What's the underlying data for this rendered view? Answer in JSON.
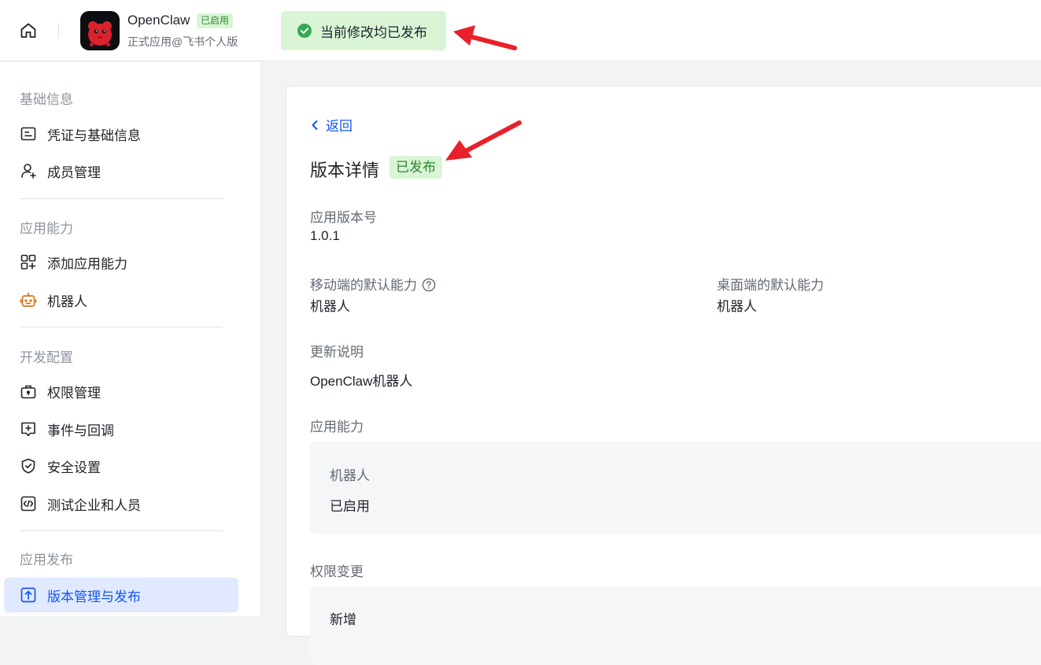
{
  "header": {
    "app_name": "OpenClaw",
    "app_status": "已启用",
    "app_subtitle": "正式应用@飞书个人版",
    "toast": "当前修改均已发布"
  },
  "sidebar": {
    "groups": [
      {
        "title": "基础信息",
        "items": [
          "凭证与基础信息",
          "成员管理"
        ]
      },
      {
        "title": "应用能力",
        "items": [
          "添加应用能力",
          "机器人"
        ]
      },
      {
        "title": "开发配置",
        "items": [
          "权限管理",
          "事件与回调",
          "安全设置",
          "测试企业和人员"
        ]
      },
      {
        "title": "应用发布",
        "items": [
          "版本管理与发布"
        ]
      }
    ],
    "active_item": "版本管理与发布"
  },
  "main": {
    "back_label": "返回",
    "title": "版本详情",
    "status_badge": "已发布",
    "version_label": "应用版本号",
    "version_value": "1.0.1",
    "mobile_label": "移动端的默认能力",
    "mobile_value": "机器人",
    "desktop_label": "桌面端的默认能力",
    "desktop_value": "机器人",
    "notes_label": "更新说明",
    "notes_value": "OpenClaw机器人",
    "capability_label": "应用能力",
    "capability_name": "机器人",
    "capability_state": "已启用",
    "permission_label": "权限变更",
    "permission_value": "新增"
  },
  "colors": {
    "accent": "#1456f0",
    "success_bg": "#d9f5d6",
    "success_text": "#2e8a32",
    "annotation_arrow": "#e8202a"
  }
}
